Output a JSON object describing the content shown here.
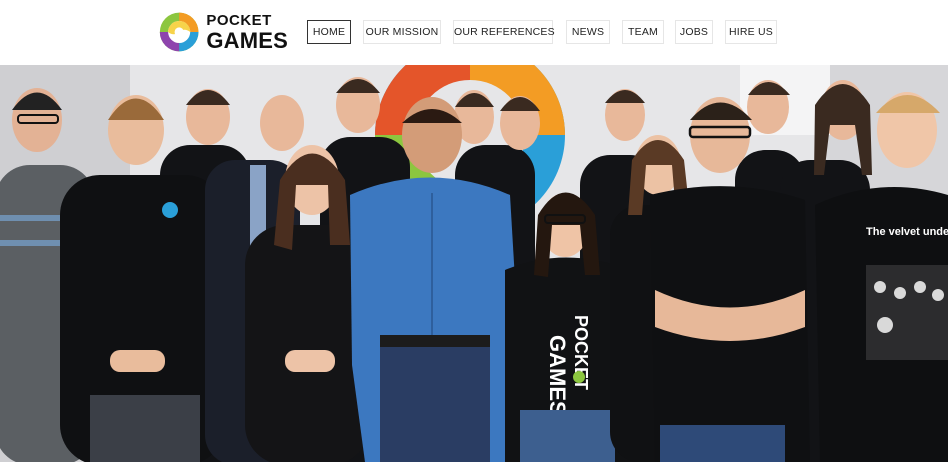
{
  "brand": {
    "logo_line1": "POCKET",
    "logo_line2": "GAMES",
    "colors": {
      "swirl_orange": "#f39c24",
      "swirl_green": "#8cc63f",
      "swirl_blue": "#2a9fd8",
      "swirl_purple": "#8e44ad"
    }
  },
  "nav": {
    "items": [
      {
        "label": "HOME",
        "active": true
      },
      {
        "label": "OUR MISSION",
        "active": false
      },
      {
        "label": "OUR REFERENCES",
        "active": false
      },
      {
        "label": "NEWS",
        "active": false
      },
      {
        "label": "TEAM",
        "active": false
      },
      {
        "label": "JOBS",
        "active": false
      },
      {
        "label": "HIRE US",
        "active": false
      }
    ]
  },
  "hero": {
    "image_description_icon": "team-photo",
    "shirt_print_front": "POCKET",
    "shirt_print_back": "GAMES",
    "band_shirt_text": "The velvet underground",
    "colors": {
      "wall": "#e9e9ea",
      "shirt_dark": "#111214",
      "blue_shirt": "#3c78c0"
    }
  }
}
